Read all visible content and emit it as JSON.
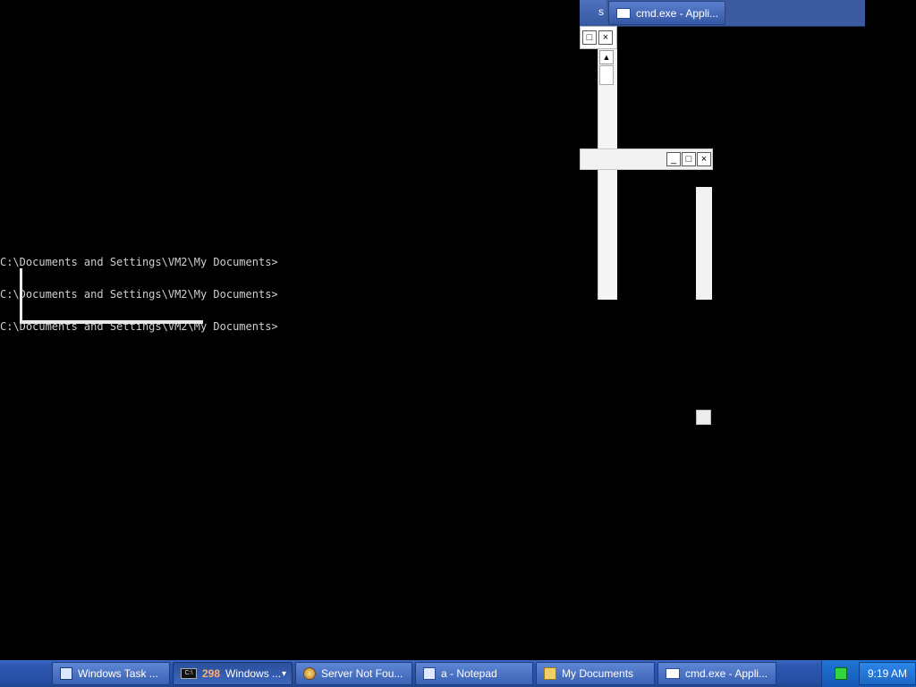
{
  "console": {
    "lines": [
      "C:\\Documents and Settings\\VM2\\My Documents>",
      "C:\\Documents and Settings\\VM2\\My Documents>",
      "C:\\Documents and Settings\\VM2\\My Documents>"
    ]
  },
  "top_fragment": {
    "left_label": "s",
    "cmd_button_label": "cmd.exe - Appli...",
    "caption_buttons": {
      "minimize": "_",
      "maximize": "□",
      "close": "×"
    },
    "scroll_up_glyph": "▲"
  },
  "taskbar": {
    "buttons": [
      {
        "label": "Windows Task ...",
        "icon": "task-manager-icon"
      },
      {
        "label": "Windows ...",
        "icon": "cmd-icon",
        "badge": "298",
        "dropdown": "▾"
      },
      {
        "label": "Server Not Fou...",
        "icon": "browser-icon"
      },
      {
        "label": "a - Notepad",
        "icon": "notepad-icon"
      },
      {
        "label": "My Documents",
        "icon": "folder-icon"
      },
      {
        "label": "cmd.exe - Appli...",
        "icon": "window-icon"
      }
    ],
    "clock": "9:19 AM"
  },
  "colors": {
    "taskbar_blue": "#2c57b0",
    "tray_blue": "#1458b5",
    "console_background": "#000000",
    "console_text": "#cfcfcf"
  }
}
